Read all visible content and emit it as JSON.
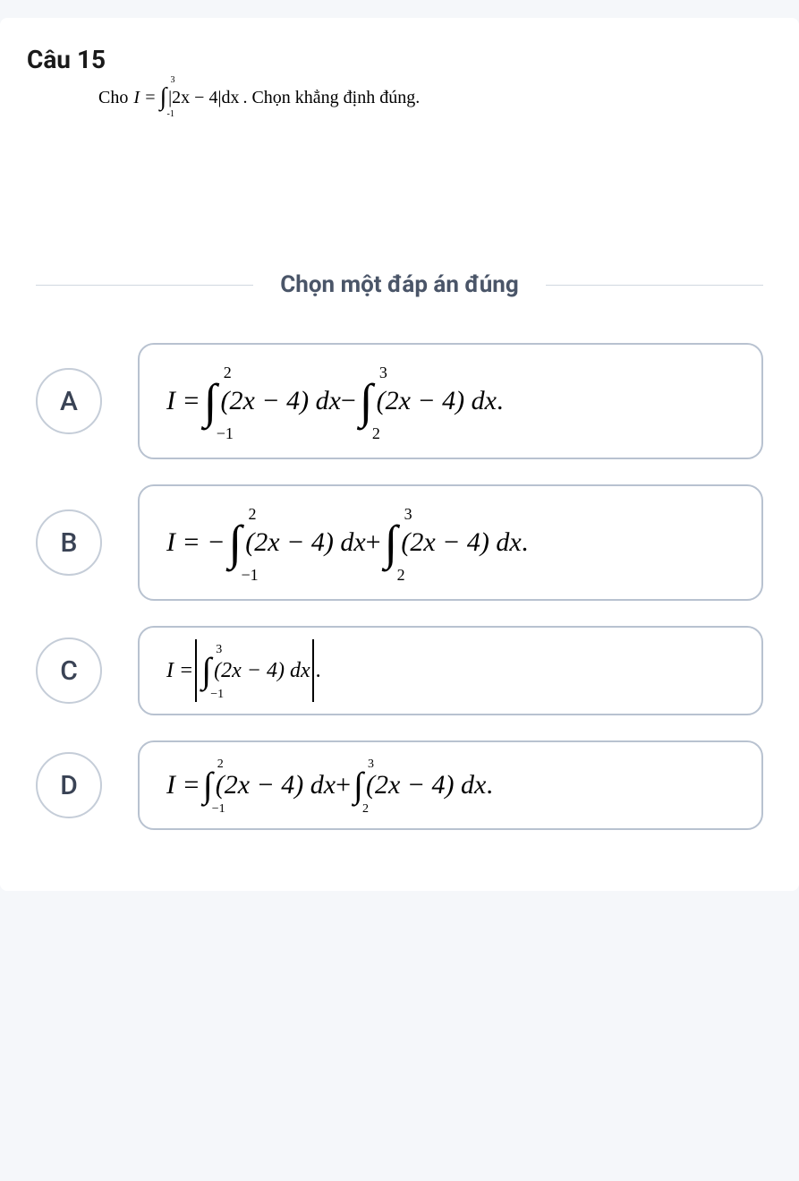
{
  "question": {
    "number": "Câu 15",
    "prefix": "Cho ",
    "equation_left": "I = ",
    "integral_upper": "3",
    "integral_lower": "-1",
    "integrand": "|2x − 4|dx",
    "suffix": ". Chọn khẳng định đúng."
  },
  "prompt": "Chọn một đáp án đúng",
  "options": {
    "A": {
      "letter": "A",
      "lhs": "I = ",
      "int1_upper": "2",
      "int1_lower": "−1",
      "int1_body": "(2x − 4) dx",
      "op": " − ",
      "int2_upper": "3",
      "int2_lower": "2",
      "int2_body": "(2x − 4) dx",
      "end": " ."
    },
    "B": {
      "letter": "B",
      "lhs": "I = − ",
      "int1_upper": "2",
      "int1_lower": "−1",
      "int1_body": "(2x − 4) dx",
      "op": " + ",
      "int2_upper": "3",
      "int2_lower": "2",
      "int2_body": "(2x − 4) dx",
      "end": " ."
    },
    "C": {
      "letter": "C",
      "lhs": "I = ",
      "int1_upper": "3",
      "int1_lower": "−1",
      "int1_body": "(2x − 4) dx",
      "end": " ."
    },
    "D": {
      "letter": "D",
      "lhs": "I = ",
      "int1_upper": "2",
      "int1_lower": "−1",
      "int1_body": "(2x − 4) dx",
      "op": " + ",
      "int2_upper": "3",
      "int2_lower": "2",
      "int2_body": "(2x − 4) dx",
      "end": " ."
    }
  }
}
